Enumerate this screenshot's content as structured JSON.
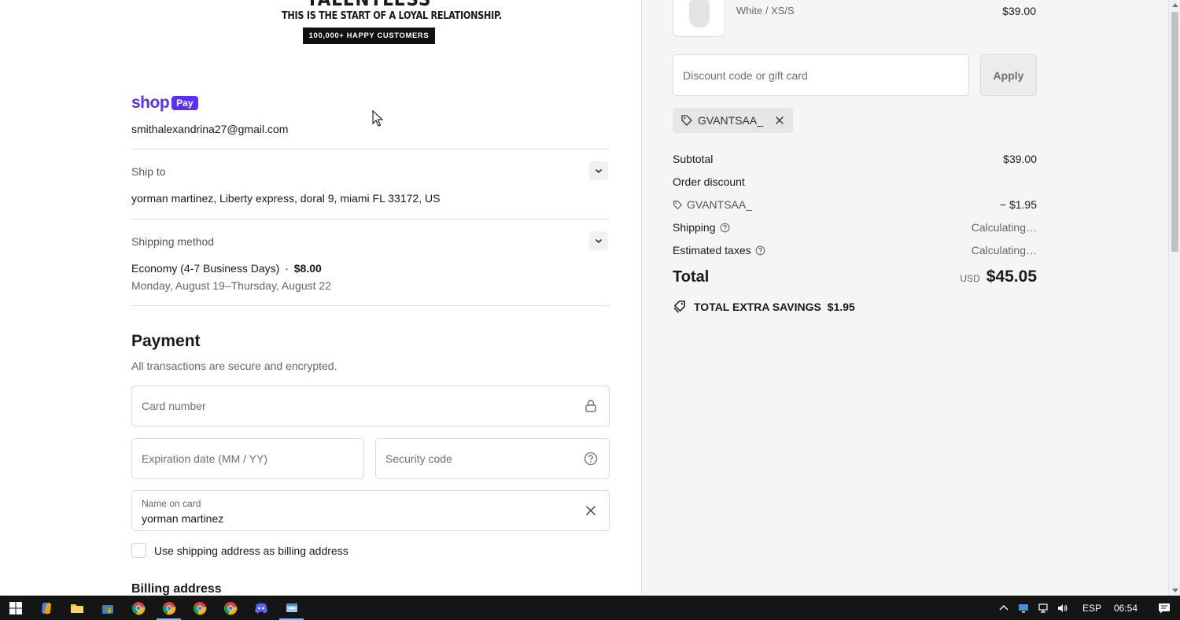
{
  "brand": {
    "name": "TALENTLESS",
    "tagline": "THIS IS THE START OF A LOYAL RELATIONSHIP.",
    "badge": "100,000+ HAPPY CUSTOMERS"
  },
  "shoppay": {
    "shop": "shop",
    "pay": "Pay",
    "email": "smithalexandrina27@gmail.com"
  },
  "ship_to": {
    "label": "Ship to",
    "value": "yorman martinez, Liberty express, doral 9, miami FL 33172, US"
  },
  "shipping_method": {
    "label": "Shipping method",
    "name": "Economy (4-7 Business Days)",
    "separator": "·",
    "price": "$8.00",
    "dates": "Monday, August 19–Thursday, August 22"
  },
  "payment": {
    "title": "Payment",
    "subtitle": "All transactions are secure and encrypted.",
    "card_number_placeholder": "Card number",
    "expiration_placeholder": "Expiration date (MM / YY)",
    "security_placeholder": "Security code",
    "name_label": "Name on card",
    "name_value": "yorman martinez",
    "billing_checkbox_label": "Use shipping address as billing address",
    "billing_title": "Billing address"
  },
  "order": {
    "variant": "White / XS/S",
    "line_price": "$39.00",
    "discount_placeholder": "Discount code or gift card",
    "apply_label": "Apply",
    "applied_code": "GVANTSAA_",
    "subtotal_label": "Subtotal",
    "subtotal_value": "$39.00",
    "order_discount_label": "Order discount",
    "discount_code": "GVANTSAA_",
    "discount_value": "− $1.95",
    "shipping_label": "Shipping",
    "shipping_value": "Calculating…",
    "taxes_label": "Estimated taxes",
    "taxes_value": "Calculating…",
    "total_label": "Total",
    "total_currency": "USD",
    "total_value": "$45.05",
    "savings_label": "TOTAL EXTRA SAVINGS",
    "savings_value": "$1.95"
  },
  "taskbar": {
    "language": "ESP",
    "clock": "06:54"
  },
  "colors": {
    "shop_purple": "#5a31f4",
    "taskbar": "#151515",
    "summary_bg": "#f5f5f5"
  }
}
